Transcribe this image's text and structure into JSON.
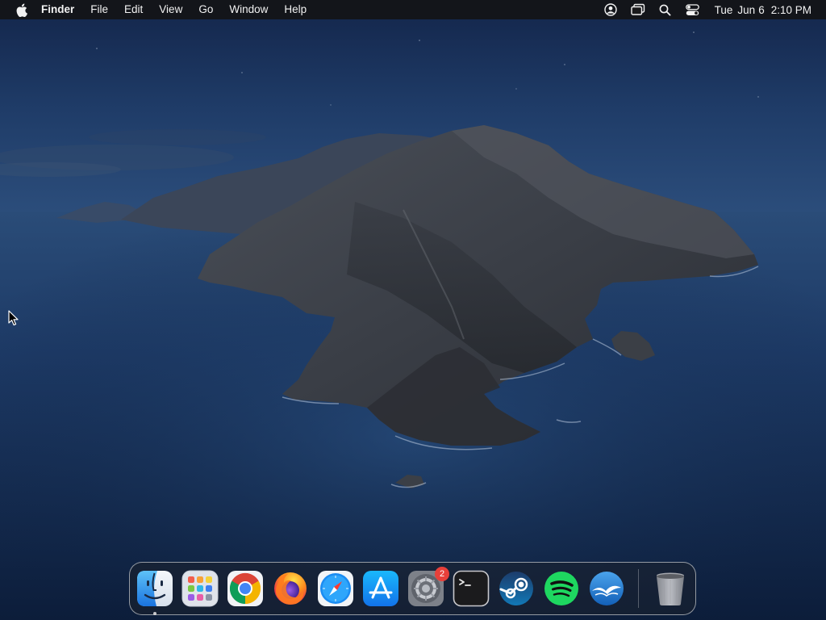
{
  "menubar": {
    "apple_icon": "apple-logo-icon",
    "app_name": "Finder",
    "menus": [
      "File",
      "Edit",
      "View",
      "Go",
      "Window",
      "Help"
    ],
    "status_icons": [
      "user-account-icon",
      "screen-mirroring-icon",
      "spotlight-search-icon",
      "control-center-icon"
    ],
    "clock": {
      "day": "Tue",
      "month": "Jun",
      "date": "6",
      "time": "2:10 PM"
    }
  },
  "dock": {
    "apps": [
      {
        "name": "Finder",
        "icon": "finder-icon",
        "running": true
      },
      {
        "name": "Launchpad",
        "icon": "launchpad-icon",
        "running": false
      },
      {
        "name": "Google Chrome",
        "icon": "chrome-icon",
        "running": false
      },
      {
        "name": "Firefox",
        "icon": "firefox-icon",
        "running": false
      },
      {
        "name": "Safari",
        "icon": "safari-icon",
        "running": false
      },
      {
        "name": "App Store",
        "icon": "app-store-icon",
        "running": false
      },
      {
        "name": "System Preferences",
        "icon": "system-preferences-icon",
        "running": false,
        "badge": "2"
      },
      {
        "name": "Terminal",
        "icon": "terminal-icon",
        "running": false
      },
      {
        "name": "Steam",
        "icon": "steam-icon",
        "running": false
      },
      {
        "name": "Spotify",
        "icon": "spotify-icon",
        "running": false
      },
      {
        "name": "OpenOffice",
        "icon": "openoffice-icon",
        "running": false
      }
    ],
    "trash": {
      "name": "Trash",
      "icon": "trash-icon"
    }
  },
  "colors": {
    "menubar_bg": "#141416",
    "badge": "#e8403a",
    "sky": "#1e3a66",
    "sea": "#142c52"
  }
}
